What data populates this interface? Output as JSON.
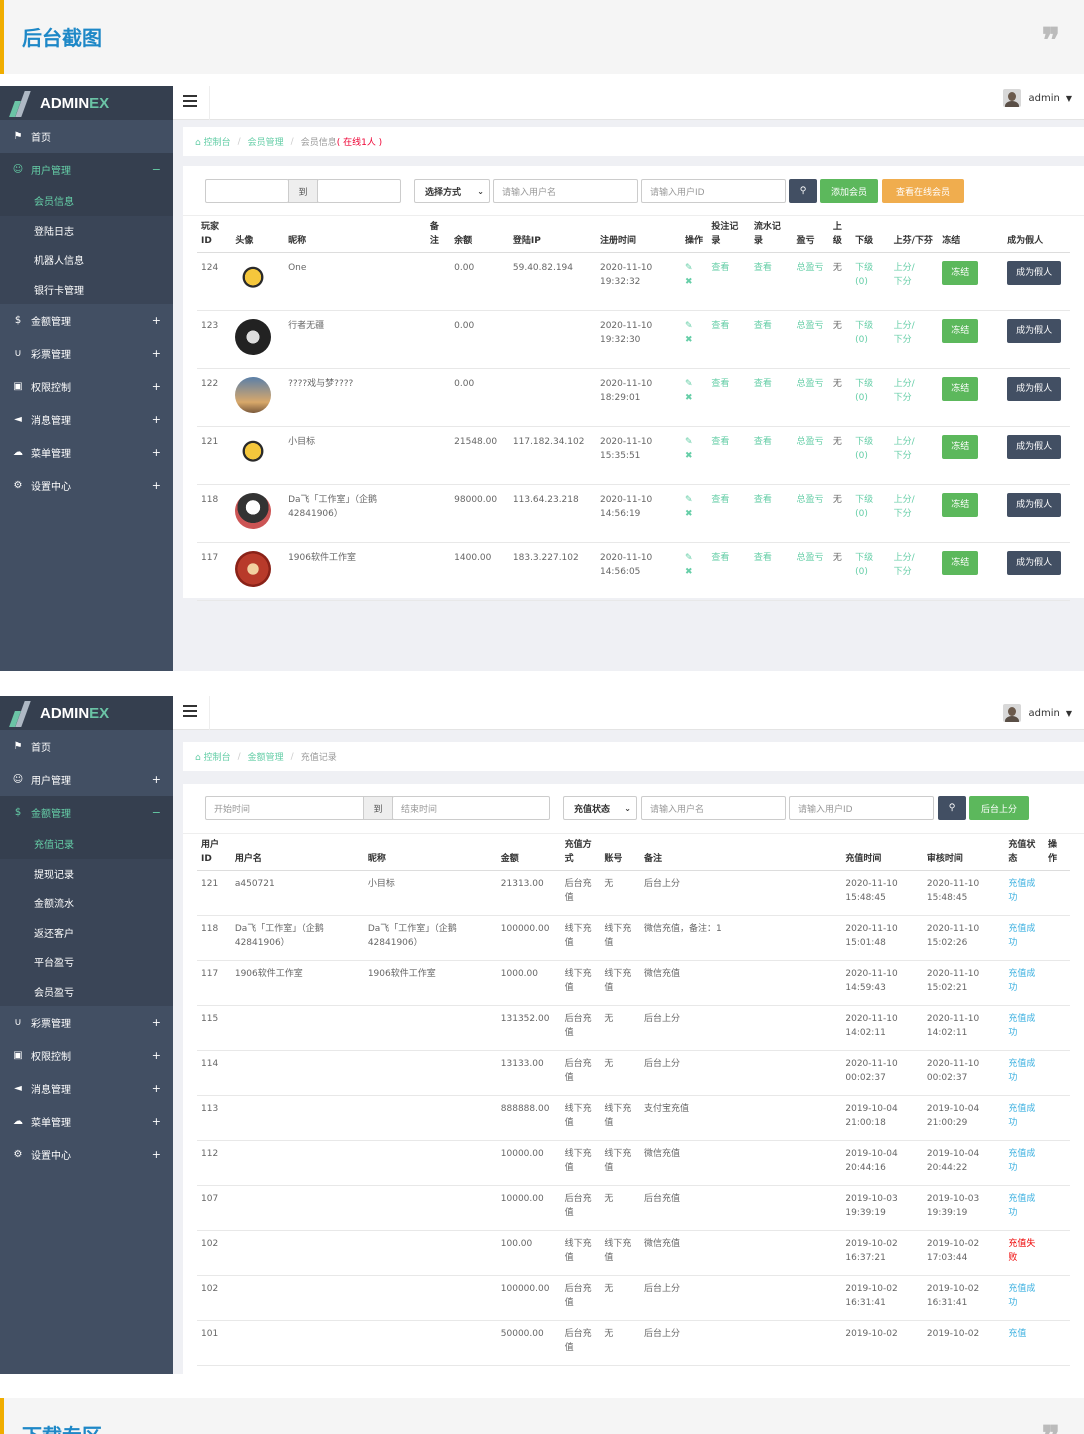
{
  "caption_top": "后台截图",
  "caption_bottom": "下载专区",
  "quote_mark": "❞",
  "brand": {
    "part1": "ADMIN",
    "part2": "EX"
  },
  "user": {
    "name": "admin"
  },
  "colors": {
    "accent": "#65cea7",
    "sidebar": "#424f63",
    "orange": "#f0ad4e",
    "green": "#5cb85c"
  },
  "screen1": {
    "nav": [
      {
        "icon": "flag-icon",
        "glyph": "⚑",
        "label": "首页",
        "pm": ""
      },
      {
        "icon": "user-icon",
        "glyph": "☺",
        "label": "用户管理",
        "pm": "−",
        "active": true
      },
      {
        "label": "会员信息",
        "sub": true,
        "on": true
      },
      {
        "label": "登陆日志",
        "sub": true
      },
      {
        "label": "机器人信息",
        "sub": true
      },
      {
        "label": "银行卡管理",
        "sub": true
      },
      {
        "icon": "dollar-icon",
        "glyph": "$",
        "label": "金额管理",
        "pm": "+"
      },
      {
        "icon": "magnet-icon",
        "glyph": "∪",
        "label": "彩票管理",
        "pm": "+"
      },
      {
        "icon": "lock-icon",
        "glyph": "▣",
        "label": "权限控制",
        "pm": "+"
      },
      {
        "icon": "bullhorn-icon",
        "glyph": "◄",
        "label": "消息管理",
        "pm": "+"
      },
      {
        "icon": "cloud-icon",
        "glyph": "☁",
        "label": "菜单管理",
        "pm": "+"
      },
      {
        "icon": "gear-icon",
        "glyph": "⚙",
        "label": "设置中心",
        "pm": "+"
      }
    ],
    "breadcrumb": {
      "home": "控制台",
      "section": "会员管理",
      "page": "会员信息",
      "online": "( 在线1人 )"
    },
    "filter": {
      "to": "到",
      "mode": "选择方式",
      "username_placeholder": "请输入用户名",
      "userid_placeholder": "请输入用户ID",
      "add": "添加会员",
      "view_online": "查看在线会员"
    },
    "headers": [
      "玩家ID",
      "头像",
      "昵称",
      "备注",
      "余额",
      "登陆IP",
      "注册时间",
      "操作",
      "投注记录",
      "流水记录",
      "盈亏",
      "上级",
      "下级",
      "上芬/下芬",
      "冻结",
      "成为假人"
    ],
    "rows": [
      {
        "id": "124",
        "nick": "One",
        "balance": "0.00",
        "ip": "59.40.82.194",
        "date": "2020-11-10",
        "time": "19:32:32"
      },
      {
        "id": "123",
        "nick": "行者无疆",
        "balance": "0.00",
        "ip": "",
        "date": "2020-11-10",
        "time": "19:32:30"
      },
      {
        "id": "122",
        "nick": "????戏与梦????",
        "balance": "0.00",
        "ip": "",
        "date": "2020-11-10",
        "time": "18:29:01"
      },
      {
        "id": "121",
        "nick": "小目标",
        "balance": "21548.00",
        "ip": "117.182.34.102",
        "date": "2020-11-10",
        "time": "15:35:51"
      },
      {
        "id": "118",
        "nick": "Da飞「工作室」（企鹅42841906）",
        "balance": "98000.00",
        "ip": "113.64.23.218",
        "date": "2020-11-10",
        "time": "14:56:19"
      },
      {
        "id": "117",
        "nick": "1906软件工作室",
        "balance": "1400.00",
        "ip": "183.3.227.102",
        "date": "2020-11-10",
        "time": "14:56:05"
      }
    ],
    "cell": {
      "view": "查看",
      "pl": "总盈亏",
      "none": "无",
      "down": "下级",
      "down_count": "(0)",
      "up": "上分/",
      "dn": "下分",
      "freeze": "冻结",
      "fake": "成为假人"
    }
  },
  "screen2": {
    "nav": [
      {
        "icon": "flag-icon",
        "glyph": "⚑",
        "label": "首页",
        "pm": ""
      },
      {
        "icon": "user-icon",
        "glyph": "☺",
        "label": "用户管理",
        "pm": "+"
      },
      {
        "icon": "dollar-icon",
        "glyph": "$",
        "label": "金额管理",
        "pm": "−",
        "active": true
      },
      {
        "label": "充值记录",
        "sub": true,
        "on": true
      },
      {
        "label": "提现记录",
        "sub": true
      },
      {
        "label": "金额流水",
        "sub": true
      },
      {
        "label": "返还客户",
        "sub": true
      },
      {
        "label": "平台盈亏",
        "sub": true
      },
      {
        "label": "会员盈亏",
        "sub": true
      },
      {
        "icon": "magnet-icon",
        "glyph": "∪",
        "label": "彩票管理",
        "pm": "+"
      },
      {
        "icon": "lock-icon",
        "glyph": "▣",
        "label": "权限控制",
        "pm": "+"
      },
      {
        "icon": "bullhorn-icon",
        "glyph": "◄",
        "label": "消息管理",
        "pm": "+"
      },
      {
        "icon": "cloud-icon",
        "glyph": "☁",
        "label": "菜单管理",
        "pm": "+"
      },
      {
        "icon": "gear-icon",
        "glyph": "⚙",
        "label": "设置中心",
        "pm": "+"
      }
    ],
    "breadcrumb": {
      "home": "控制台",
      "section": "金额管理",
      "page": "充值记录"
    },
    "filter": {
      "start": "开始时间",
      "to": "到",
      "end": "结束时间",
      "status": "充值状态",
      "username_placeholder": "请输入用户名",
      "userid_placeholder": "请输入用户ID",
      "topup": "后台上分"
    },
    "headers": [
      "用户ID",
      "用户名",
      "昵称",
      "金额",
      "充值方式",
      "账号",
      "备注",
      "充值时间",
      "审核时间",
      "充值状态",
      "操作"
    ],
    "rows": [
      {
        "id": "121",
        "user": "a450721",
        "nick": "小目标",
        "amount": "21313.00",
        "method": "后台充值",
        "acct": "无",
        "note": "后台上分",
        "t1d": "2020-11-10",
        "t1t": "15:48:45",
        "t2d": "2020-11-10",
        "t2t": "15:48:45",
        "status": "充值成功",
        "ok": true
      },
      {
        "id": "118",
        "user": "Da飞「工作室」（企鹅42841906）",
        "nick": "Da飞「工作室」（企鹅42841906）",
        "amount": "100000.00",
        "method": "线下充值",
        "acct": "线下充值",
        "note": "微信充值，备注：1",
        "t1d": "2020-11-10",
        "t1t": "15:01:48",
        "t2d": "2020-11-10",
        "t2t": "15:02:26",
        "status": "充值成功",
        "ok": true
      },
      {
        "id": "117",
        "user": "1906软件工作室",
        "nick": "1906软件工作室",
        "amount": "1000.00",
        "method": "线下充值",
        "acct": "线下充值",
        "note": "微信充值",
        "t1d": "2020-11-10",
        "t1t": "14:59:43",
        "t2d": "2020-11-10",
        "t2t": "15:02:21",
        "status": "充值成功",
        "ok": true
      },
      {
        "id": "115",
        "user": "",
        "nick": "",
        "amount": "131352.00",
        "method": "后台充值",
        "acct": "无",
        "note": "后台上分",
        "t1d": "2020-11-10",
        "t1t": "14:02:11",
        "t2d": "2020-11-10",
        "t2t": "14:02:11",
        "status": "充值成功",
        "ok": true
      },
      {
        "id": "114",
        "user": "",
        "nick": "",
        "amount": "13133.00",
        "method": "后台充值",
        "acct": "无",
        "note": "后台上分",
        "t1d": "2020-11-10",
        "t1t": "00:02:37",
        "t2d": "2020-11-10",
        "t2t": "00:02:37",
        "status": "充值成功",
        "ok": true
      },
      {
        "id": "113",
        "user": "",
        "nick": "",
        "amount": "888888.00",
        "method": "线下充值",
        "acct": "线下充值",
        "note": "支付宝充值",
        "t1d": "2019-10-04",
        "t1t": "21:00:18",
        "t2d": "2019-10-04",
        "t2t": "21:00:29",
        "status": "充值成功",
        "ok": true
      },
      {
        "id": "112",
        "user": "",
        "nick": "",
        "amount": "10000.00",
        "method": "线下充值",
        "acct": "线下充值",
        "note": "微信充值",
        "t1d": "2019-10-04",
        "t1t": "20:44:16",
        "t2d": "2019-10-04",
        "t2t": "20:44:22",
        "status": "充值成功",
        "ok": true
      },
      {
        "id": "107",
        "user": "",
        "nick": "",
        "amount": "10000.00",
        "method": "后台充值",
        "acct": "无",
        "note": "后台充值",
        "t1d": "2019-10-03",
        "t1t": "19:39:19",
        "t2d": "2019-10-03",
        "t2t": "19:39:19",
        "status": "充值成功",
        "ok": true
      },
      {
        "id": "102",
        "user": "",
        "nick": "",
        "amount": "100.00",
        "method": "线下充值",
        "acct": "线下充值",
        "note": "微信充值",
        "t1d": "2019-10-02",
        "t1t": "16:37:21",
        "t2d": "2019-10-02",
        "t2t": "17:03:44",
        "status": "充值失败",
        "ok": false
      },
      {
        "id": "102",
        "user": "",
        "nick": "",
        "amount": "100000.00",
        "method": "后台充值",
        "acct": "无",
        "note": "后台上分",
        "t1d": "2019-10-02",
        "t1t": "16:31:41",
        "t2d": "2019-10-02",
        "t2t": "16:31:41",
        "status": "充值成功",
        "ok": true
      },
      {
        "id": "101",
        "user": "",
        "nick": "",
        "amount": "50000.00",
        "method": "后台充值",
        "acct": "无",
        "note": "后台上分",
        "t1d": "2019-10-02",
        "t1t": "",
        "t2d": "2019-10-02",
        "t2t": "",
        "status": "充值",
        "ok": true
      }
    ]
  }
}
